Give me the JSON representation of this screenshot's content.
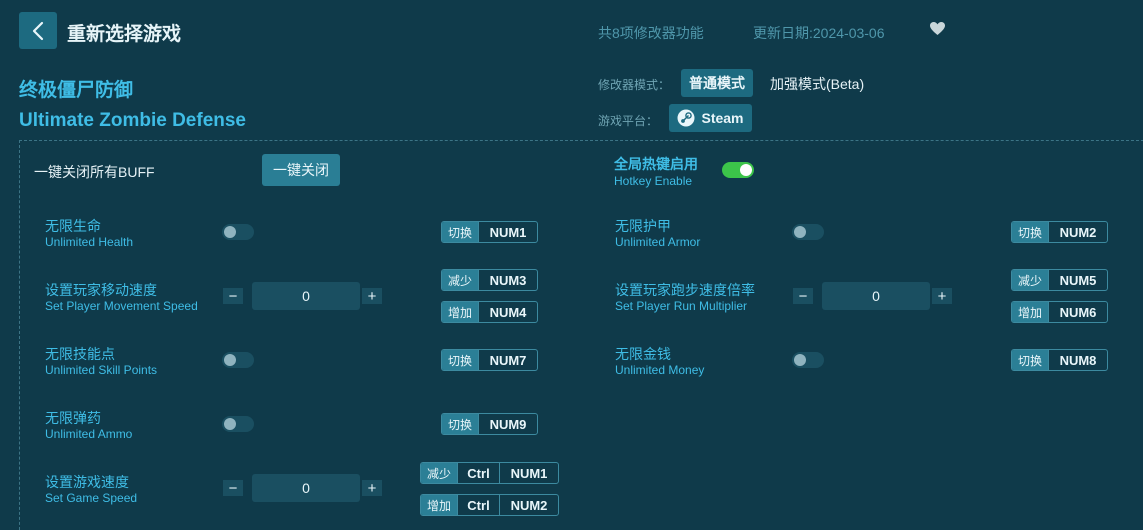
{
  "header": {
    "title": "重新选择游戏",
    "feature_count": "共8项修改器功能",
    "update_date": "更新日期:2024-03-06"
  },
  "game": {
    "name_cn": "终极僵尸防御",
    "name_en": "Ultimate Zombie Defense"
  },
  "mode": {
    "label": "修改器模式：",
    "normal": "普通模式",
    "enhanced": "加强模式(Beta)"
  },
  "platform": {
    "label": "游戏平台：",
    "name": "Steam"
  },
  "controls": {
    "close_all_label": "一键关闭所有BUFF",
    "close_all_button": "一键关闭",
    "hotkey_cn": "全局热键启用",
    "hotkey_en": "Hotkey Enable",
    "hotkey_enabled": true
  },
  "options": [
    {
      "cn": "无限生命",
      "en": "Unlimited Health",
      "type": "toggle",
      "on": false,
      "keys": [
        {
          "action": "切换",
          "keys": [
            "NUM1"
          ]
        }
      ]
    },
    {
      "cn": "无限护甲",
      "en": "Unlimited Armor",
      "type": "toggle",
      "on": false,
      "keys": [
        {
          "action": "切换",
          "keys": [
            "NUM2"
          ]
        }
      ]
    },
    {
      "cn": "设置玩家移动速度",
      "en": "Set Player Movement Speed",
      "type": "stepper",
      "value": "0",
      "keys": [
        {
          "action": "减少",
          "keys": [
            "NUM3"
          ]
        },
        {
          "action": "增加",
          "keys": [
            "NUM4"
          ]
        }
      ]
    },
    {
      "cn": "设置玩家跑步速度倍率",
      "en": "Set Player Run Multiplier",
      "type": "stepper",
      "value": "0",
      "keys": [
        {
          "action": "减少",
          "keys": [
            "NUM5"
          ]
        },
        {
          "action": "增加",
          "keys": [
            "NUM6"
          ]
        }
      ]
    },
    {
      "cn": "无限技能点",
      "en": "Unlimited Skill Points",
      "type": "toggle",
      "on": false,
      "keys": [
        {
          "action": "切换",
          "keys": [
            "NUM7"
          ]
        }
      ]
    },
    {
      "cn": "无限金钱",
      "en": "Unlimited Money",
      "type": "toggle",
      "on": false,
      "keys": [
        {
          "action": "切换",
          "keys": [
            "NUM8"
          ]
        }
      ]
    },
    {
      "cn": "无限弹药",
      "en": "Unlimited Ammo",
      "type": "toggle",
      "on": false,
      "keys": [
        {
          "action": "切换",
          "keys": [
            "NUM9"
          ]
        }
      ]
    },
    {
      "cn": "设置游戏速度",
      "en": "Set Game Speed",
      "type": "stepper",
      "value": "0",
      "keys": [
        {
          "action": "减少",
          "keys": [
            "Ctrl",
            "NUM1"
          ]
        },
        {
          "action": "增加",
          "keys": [
            "Ctrl",
            "NUM2"
          ]
        }
      ]
    }
  ],
  "stepper_symbols": {
    "minus": "−",
    "plus": "+"
  }
}
